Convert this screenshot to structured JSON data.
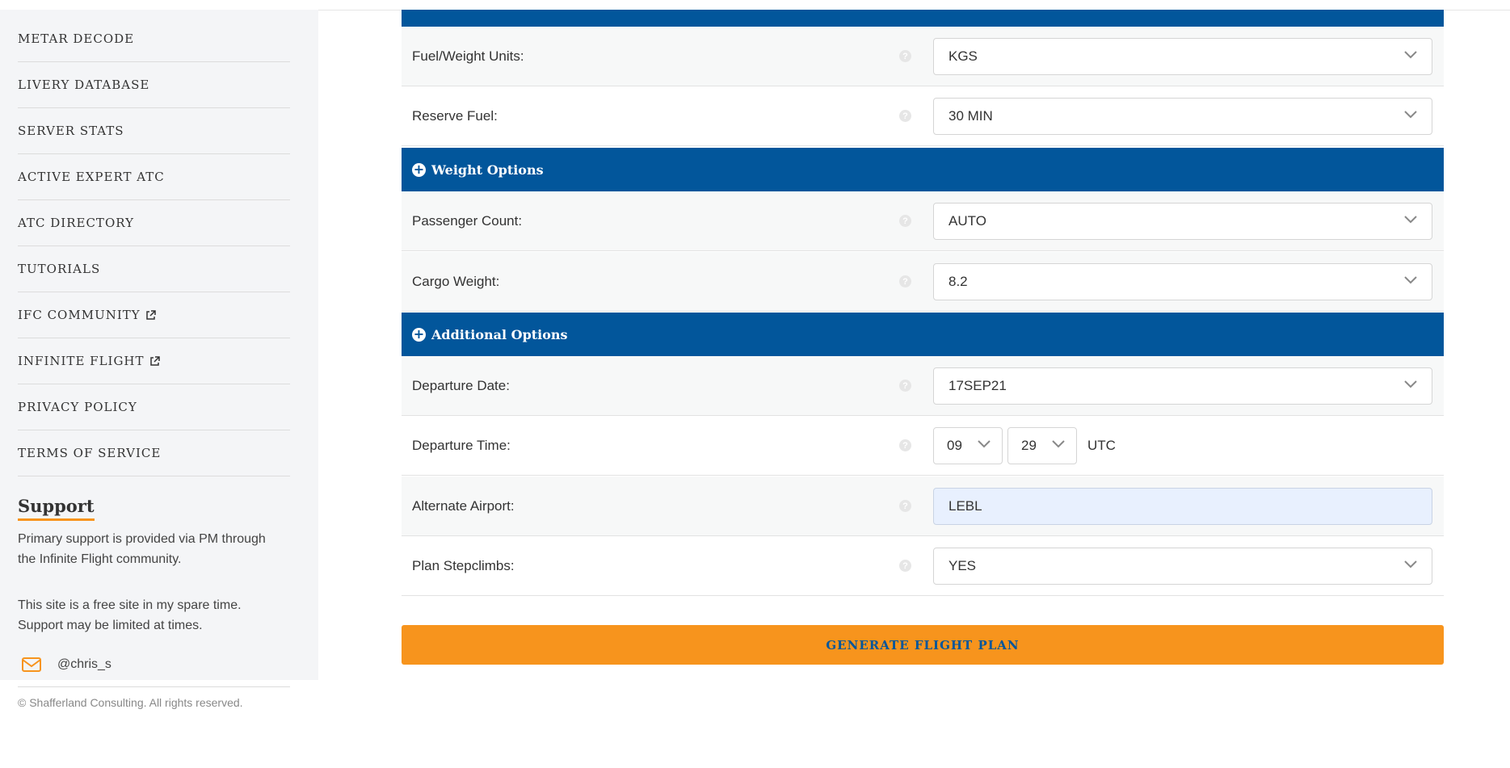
{
  "sidebar": {
    "nav": [
      {
        "label": "METAR DECODE",
        "external": false
      },
      {
        "label": "LIVERY DATABASE",
        "external": false
      },
      {
        "label": "SERVER STATS",
        "external": false
      },
      {
        "label": "ACTIVE EXPERT ATC",
        "external": false
      },
      {
        "label": "ATC DIRECTORY",
        "external": false
      },
      {
        "label": "TUTORIALS",
        "external": false
      },
      {
        "label": "IFC COMMUNITY",
        "external": true
      },
      {
        "label": "INFINITE FLIGHT",
        "external": true
      },
      {
        "label": "PRIVACY POLICY",
        "external": false
      },
      {
        "label": "TERMS OF SERVICE",
        "external": false
      }
    ],
    "support": {
      "title": "Support",
      "text1": "Primary support is provided via PM through the Infinite Flight community.",
      "text2": "This site is a free site in my spare time. Support may be limited at times.",
      "email_handle": "@chris_s"
    },
    "copyright": "© Shafferland Consulting. All rights reserved."
  },
  "form": {
    "fuel_units": {
      "label": "Fuel/Weight Units:",
      "value": "KGS"
    },
    "reserve_fuel": {
      "label": "Reserve Fuel:",
      "value": "30 MIN"
    },
    "weight_section": "Weight Options",
    "passenger_count": {
      "label": "Passenger Count:",
      "value": "AUTO"
    },
    "cargo_weight": {
      "label": "Cargo Weight:",
      "value": "8.2"
    },
    "additional_section": "Additional Options",
    "departure_date": {
      "label": "Departure Date:",
      "value": "17SEP21"
    },
    "departure_time": {
      "label": "Departure Time:",
      "hour": "09",
      "minute": "29",
      "tz": "UTC"
    },
    "alternate_airport": {
      "label": "Alternate Airport:",
      "value": "LEBL"
    },
    "plan_stepclimbs": {
      "label": "Plan Stepclimbs:",
      "value": "YES"
    },
    "generate_label": "GENERATE FLIGHT PLAN"
  },
  "colors": {
    "brand_blue": "#02569b",
    "accent_orange": "#f7941d"
  }
}
